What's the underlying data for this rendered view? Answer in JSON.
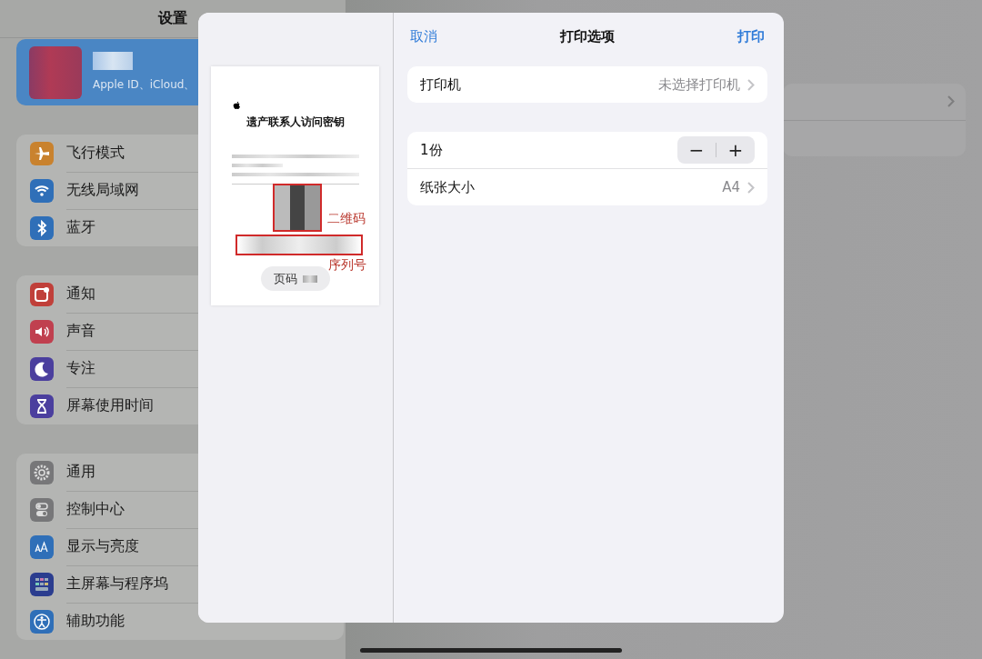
{
  "sidebar": {
    "title": "设置",
    "account": {
      "subtitle": "Apple ID、iCloud、"
    },
    "groups": [
      [
        {
          "label": "飞行模式",
          "color": "#c9822e"
        },
        {
          "label": "无线局域网",
          "color": "#2f6fb8"
        },
        {
          "label": "蓝牙",
          "color": "#2f6fb8"
        }
      ],
      [
        {
          "label": "通知",
          "color": "#c0403a"
        },
        {
          "label": "声音",
          "color": "#c0404f"
        },
        {
          "label": "专注",
          "color": "#4b3f9e"
        },
        {
          "label": "屏幕使用时间",
          "color": "#4b3f9e"
        }
      ],
      [
        {
          "label": "通用",
          "color": "#777779"
        },
        {
          "label": "控制中心",
          "color": "#777779"
        },
        {
          "label": "显示与亮度",
          "color": "#2f6fb8"
        },
        {
          "label": "主屏幕与程序坞",
          "color": "#2b3d8f"
        },
        {
          "label": "辅助功能",
          "color": "#2f6fb8"
        }
      ]
    ]
  },
  "print_sheet": {
    "cancel": "取消",
    "title": "打印选项",
    "print": "打印",
    "preview": {
      "title": "遗产联系人访问密钥",
      "annotations": [
        {
          "label": "二维码"
        },
        {
          "label": "序列号"
        }
      ],
      "page_label": "页码"
    },
    "printer": {
      "label": "打印机",
      "value": "未选择打印机"
    },
    "copies": {
      "label": "1份",
      "minus": "−",
      "plus": "+"
    },
    "paper": {
      "label": "纸张大小",
      "value": "A4"
    }
  }
}
